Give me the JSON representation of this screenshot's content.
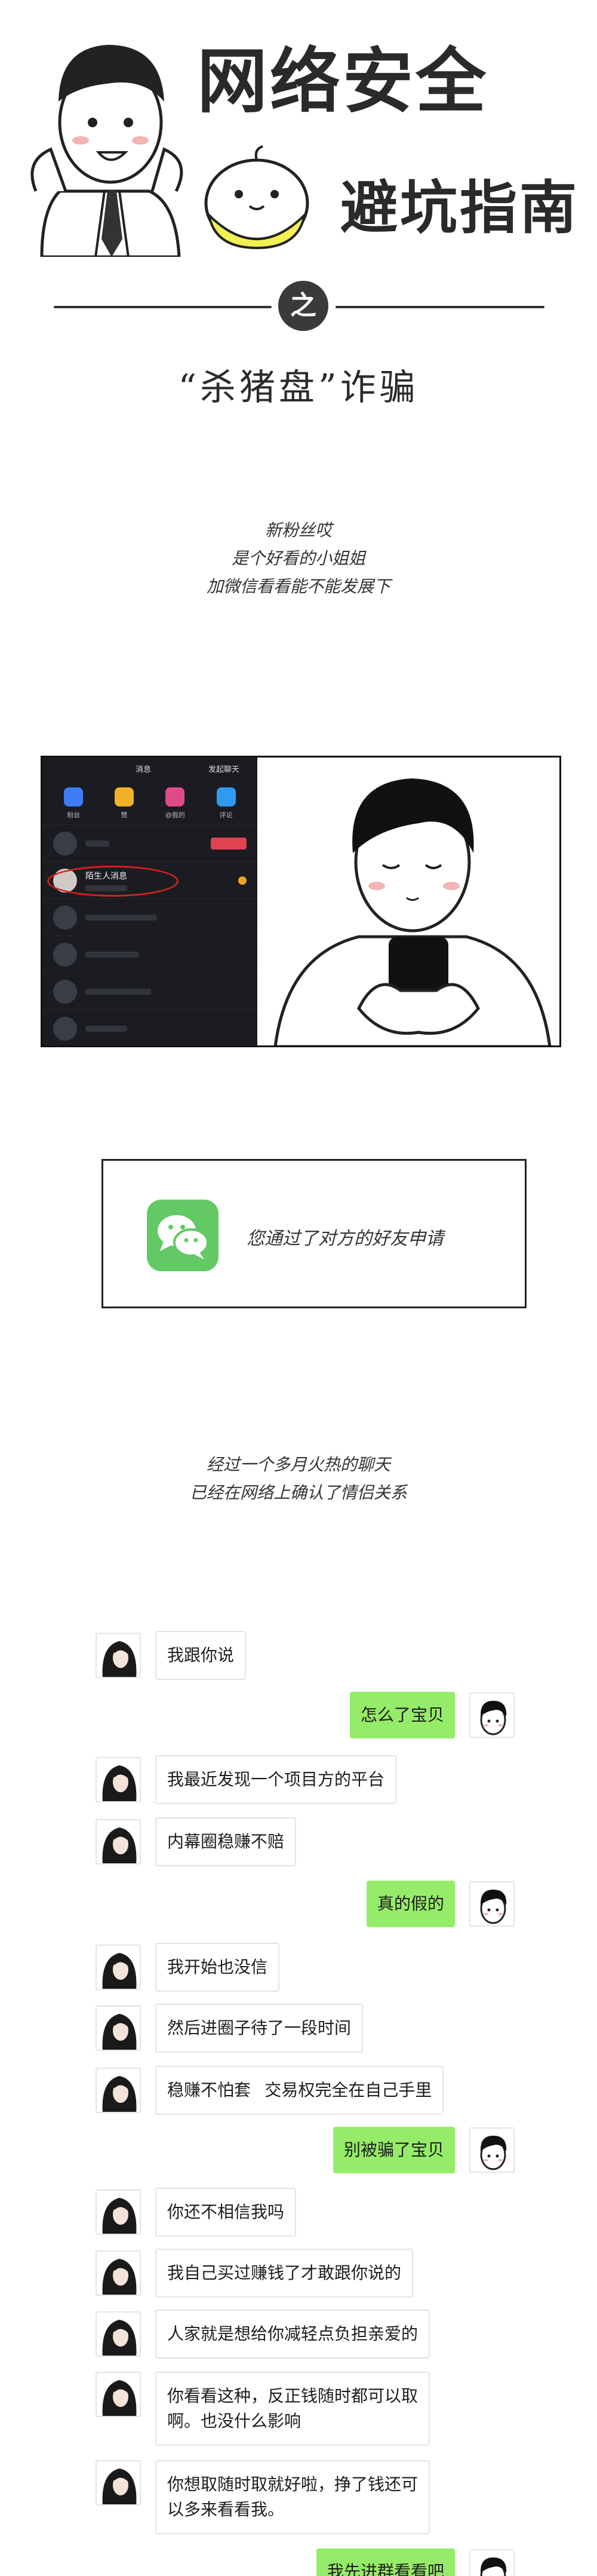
{
  "header": {
    "title_line1": "网络安全",
    "title_line2": "避坑指南",
    "divider_char": "之",
    "subtitle": "“杀猪盘”诈骗"
  },
  "intro": {
    "lines": [
      "新粉丝哎",
      "是个好看的小姐姐",
      "加微信看看能不能发展下"
    ]
  },
  "phone": {
    "status_center": "消息",
    "status_right": "发起聊天",
    "tabs": [
      "粉丝",
      "赞",
      "@我的",
      "评论"
    ],
    "highlight_name": "陌生人消息",
    "colors": {
      "tab1": "#3f7cf4",
      "tab2": "#f2b12a",
      "tab3": "#e14a88",
      "tab4": "#2f9bf0",
      "ring": "#d61f1f"
    }
  },
  "wechat": {
    "icon": "wechat-icon",
    "text": "您通过了对方的好友申请",
    "color": "#62c965"
  },
  "relationship": {
    "lines": [
      "经过一个多月火热的聊天",
      "已经在网络上确认了情侣关系"
    ]
  },
  "chat": {
    "bubble_colors": {
      "left": "#ffffff",
      "right": "#95ec69"
    },
    "messages": [
      {
        "side": "left",
        "text": "我跟你说"
      },
      {
        "side": "right",
        "text": "怎么了宝贝"
      },
      {
        "side": "left",
        "text": "我最近发现一个项目方的平台"
      },
      {
        "side": "left",
        "text": "内幕圈稳赚不赔"
      },
      {
        "side": "right",
        "text": "真的假的"
      },
      {
        "side": "left",
        "text": "我开始也没信"
      },
      {
        "side": "left",
        "text": "然后进圈子待了一段时间"
      },
      {
        "side": "left",
        "text": "稳赚不怕套   交易权完全在自己手里"
      },
      {
        "side": "right",
        "text": "别被骗了宝贝"
      },
      {
        "side": "left",
        "text": "你还不相信我吗"
      },
      {
        "side": "left",
        "text": "我自己买过赚钱了才敢跟你说的"
      },
      {
        "side": "left",
        "text": "人家就是想给你减轻点负担亲爱的"
      },
      {
        "side": "left",
        "text": "你看看这种，反正钱随时都可以取啊。也没什么影响"
      },
      {
        "side": "left",
        "text": "你想取随时取就好啦，挣了钱还可以多来看看我。"
      },
      {
        "side": "right",
        "text": "我先进群看看吧"
      }
    ]
  }
}
